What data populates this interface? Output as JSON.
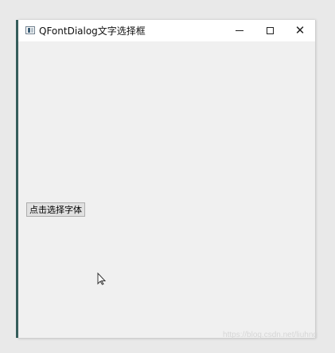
{
  "window": {
    "title": "QFontDialog文字选择框"
  },
  "controls": {
    "minimize": "—",
    "maximize": "□",
    "close": "✕"
  },
  "main": {
    "button_label": "点击选择字体"
  },
  "watermark": {
    "text": "https://blog.csdn.net/liuhng"
  },
  "icons": {
    "app": "window-app-icon",
    "cursor": "mouse-pointer-icon"
  },
  "colors": {
    "background": "#e9e9e9",
    "window": "#f0f0f0",
    "titlebar": "#ffffff",
    "accent": "#355d5b",
    "button": "#e1e1e1"
  }
}
